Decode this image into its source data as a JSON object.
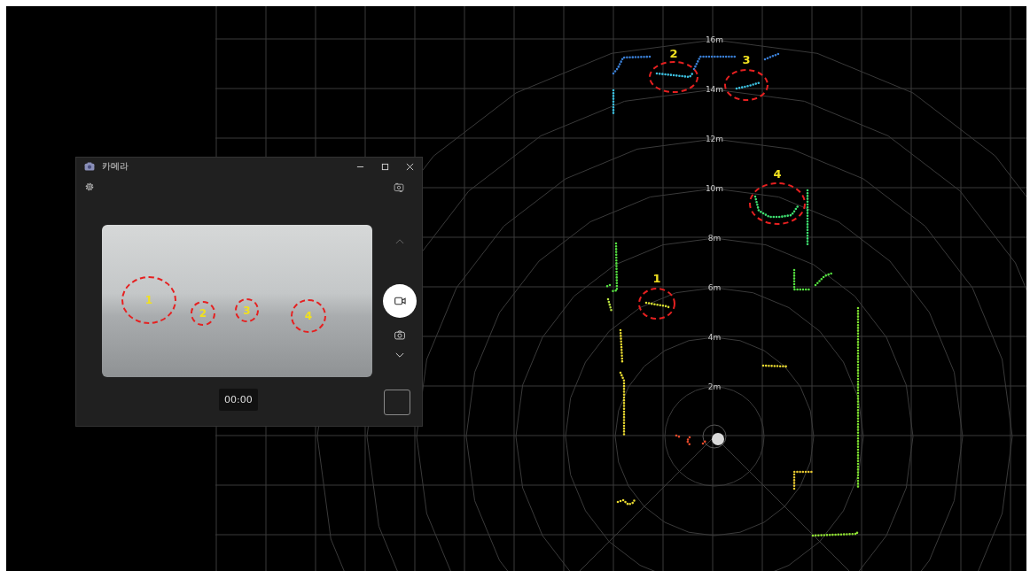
{
  "lidar_view": {
    "range_labels": [
      "16m",
      "14m",
      "12m",
      "10m",
      "8m",
      "6m",
      "4m",
      "2m"
    ],
    "markers": [
      {
        "label": "1"
      },
      {
        "label": "2"
      },
      {
        "label": "3"
      },
      {
        "label": "4"
      }
    ]
  },
  "camera_window": {
    "title": "카메라",
    "preview_markers": [
      {
        "label": "1"
      },
      {
        "label": "2"
      },
      {
        "label": "3"
      },
      {
        "label": "4"
      }
    ],
    "timer": "00:00"
  }
}
